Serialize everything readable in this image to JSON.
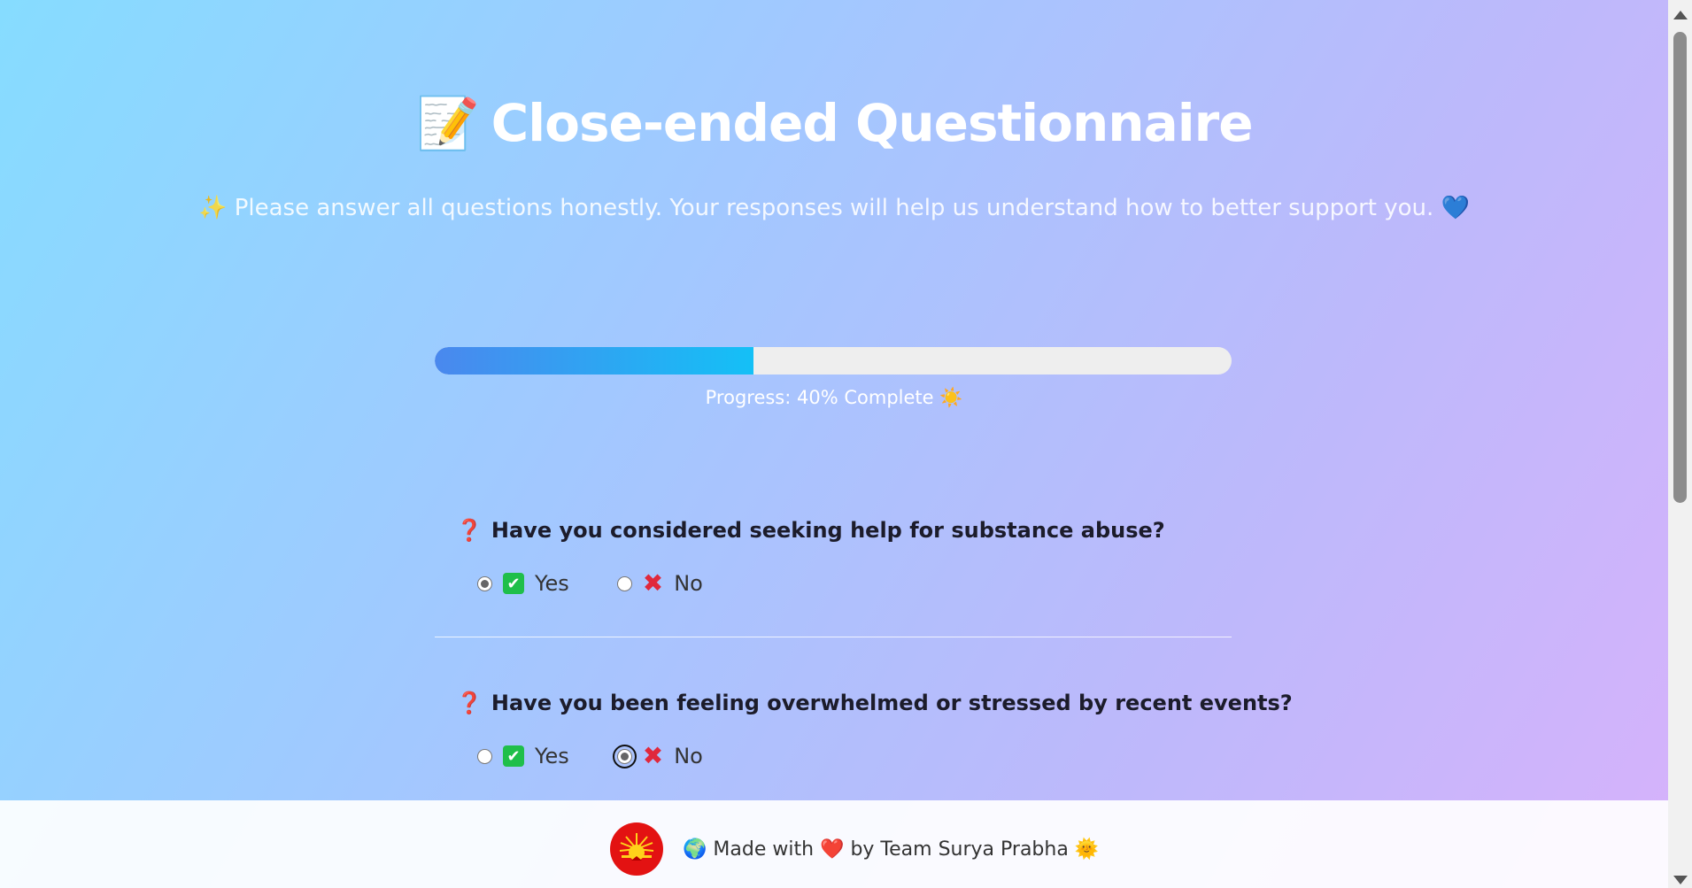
{
  "header": {
    "title_emoji": "📝",
    "title": "Close-ended Questionnaire",
    "subtitle": "✨ Please answer all questions honestly. Your responses will help us understand how to better support you. 💙"
  },
  "progress": {
    "percent": 40,
    "text": "Progress: 40% Complete ☀️",
    "fill_colors": [
      "#4a88ee",
      "#14c0f6"
    ]
  },
  "questions": [
    {
      "icon": "❓",
      "text": "Have you considered seeking help for substance abuse?",
      "options": [
        {
          "icon": "✔",
          "label": "Yes",
          "selected": true
        },
        {
          "icon": "✖",
          "label": "No",
          "selected": false
        }
      ]
    },
    {
      "icon": "❓",
      "text": "Have you been feeling overwhelmed or stressed by recent events?",
      "options": [
        {
          "icon": "✔",
          "label": "Yes",
          "selected": false
        },
        {
          "icon": "✖",
          "label": "No",
          "selected": true
        }
      ]
    }
  ],
  "footer": {
    "globe": "🌍",
    "made_with": "Made with",
    "heart": "❤️",
    "by": "by Team Surya Prabha",
    "sun": "🌞"
  },
  "colors": {
    "accent_red": "#e0283c",
    "check_green": "#1fbf4a",
    "logo_red": "#e31212"
  }
}
